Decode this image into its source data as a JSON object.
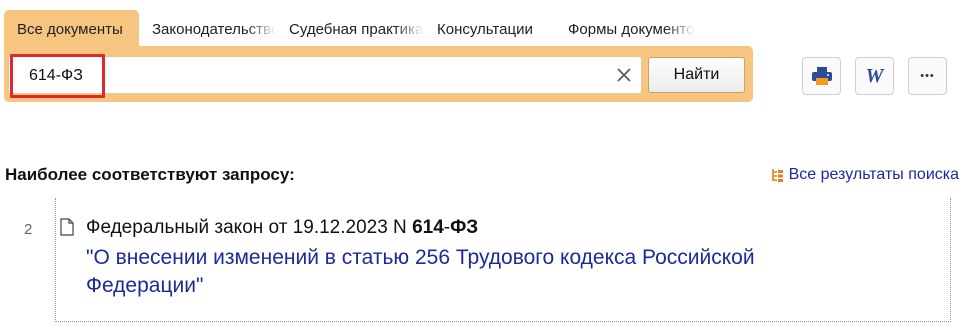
{
  "tabs": [
    {
      "label": "Все документы",
      "active": true
    },
    {
      "label": "Законодательство",
      "active": false
    },
    {
      "label": "Судебная практика",
      "active": false
    },
    {
      "label": "Консультации",
      "active": false
    },
    {
      "label": "Формы документов",
      "active": false
    }
  ],
  "search": {
    "value": "614-ФЗ",
    "button_label": "Найти"
  },
  "toolbar": {
    "icons": [
      "printer-icon",
      "word-icon",
      "more-icon"
    ],
    "word_glyph": "W",
    "more_glyph": "•••"
  },
  "results": {
    "heading": "Наиболее соответствуют запросу:",
    "all_results_label": "Все результаты поиска",
    "items": [
      {
        "number": "2",
        "line_prefix": "Федеральный закон от 19.12.2023 N ",
        "line_number": "614",
        "line_sep": "-",
        "line_suffix": "ФЗ",
        "title": "\"О внесении изменений в статью 256 Трудового кодекса Российской Федерации\""
      }
    ]
  },
  "colors": {
    "accent": "#f6c57f",
    "highlight": "#e3262a",
    "link": "#1b2a9c"
  }
}
